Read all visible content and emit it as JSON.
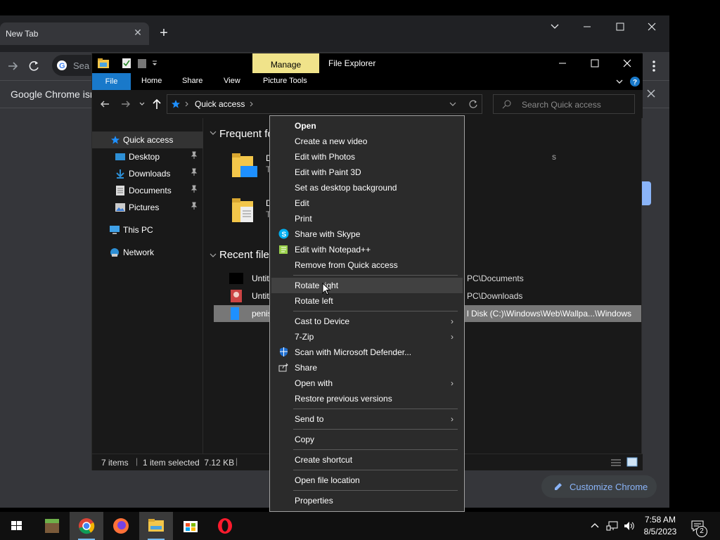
{
  "chrome": {
    "tab_title": "New Tab",
    "tab_close": "✕",
    "new_tab": "+",
    "omnibox_text": "Sea",
    "infobar_text": "Google Chrome isn't",
    "customize_label": "Customize Chrome",
    "window_controls": {
      "minimize": "—",
      "maximize": "☐",
      "close": "✕",
      "chevron": "⌄"
    }
  },
  "explorer": {
    "title": "File Explorer",
    "manage_tab": "Manage",
    "ribbon_tabs": [
      "File",
      "Home",
      "Share",
      "View",
      "Picture Tools"
    ],
    "address_crumb": "Quick access",
    "search_placeholder": "Search Quick access",
    "nav": [
      {
        "label": "Quick access"
      },
      {
        "label": "Desktop"
      },
      {
        "label": "Downloads"
      },
      {
        "label": "Documents"
      },
      {
        "label": "Pictures"
      },
      {
        "label": "This PC"
      },
      {
        "label": "Network"
      }
    ],
    "frequent_heading": "Frequent fo",
    "frequent_items": [
      {
        "a": "D",
        "b": "T"
      },
      {
        "a": "D",
        "b": "T"
      }
    ],
    "frequent_overflow": "s",
    "recent_heading": "Recent files",
    "recent_files": [
      {
        "name": "Untit",
        "path": "PC\\Documents"
      },
      {
        "name": "Untit",
        "path": "PC\\Downloads"
      },
      {
        "name": "penis",
        "path": "l Disk (C:)\\Windows\\Web\\Wallpa...\\Windows"
      }
    ],
    "status": {
      "items": "7 items",
      "selected": "1 item selected  7.12 KB"
    }
  },
  "context_menu": {
    "items": [
      {
        "label": "Open",
        "bold": true
      },
      {
        "label": "Create a new video"
      },
      {
        "label": "Edit with Photos"
      },
      {
        "label": "Edit with Paint 3D"
      },
      {
        "label": "Set as desktop background"
      },
      {
        "label": "Edit"
      },
      {
        "label": "Print"
      },
      {
        "label": "Share with Skype",
        "icon": "skype-icon"
      },
      {
        "label": "Edit with Notepad++",
        "icon": "notepadpp-icon"
      },
      {
        "label": "Remove from Quick access"
      },
      {
        "label": "Rotate right",
        "highlight": true
      },
      {
        "label": "Rotate left"
      },
      {
        "label": "Cast to Device",
        "submenu": true
      },
      {
        "label": "7-Zip",
        "submenu": true
      },
      {
        "label": "Scan with Microsoft Defender...",
        "icon": "defender-icon"
      },
      {
        "label": "Share",
        "icon": "share-icon"
      },
      {
        "label": "Open with",
        "submenu": true
      },
      {
        "label": "Restore previous versions"
      },
      {
        "label": "Send to",
        "submenu": true
      },
      {
        "label": "Copy"
      },
      {
        "label": "Create shortcut"
      },
      {
        "label": "Open file location"
      },
      {
        "label": "Properties"
      }
    ],
    "arrow": "›"
  },
  "taskbar": {
    "time": "7:58 AM",
    "date": "8/5/2023",
    "notification_count": "2",
    "apps": [
      "start-icon",
      "minecraft-icon",
      "chrome-icon",
      "firefox-icon",
      "file-explorer-icon",
      "store-icon",
      "opera-icon"
    ]
  },
  "colors": {
    "accent": "#1979ca",
    "manage": "#f0e38a",
    "selection": "#777777",
    "menu_bg": "#2b2b2b",
    "chrome_blue": "#8ab4f8"
  }
}
